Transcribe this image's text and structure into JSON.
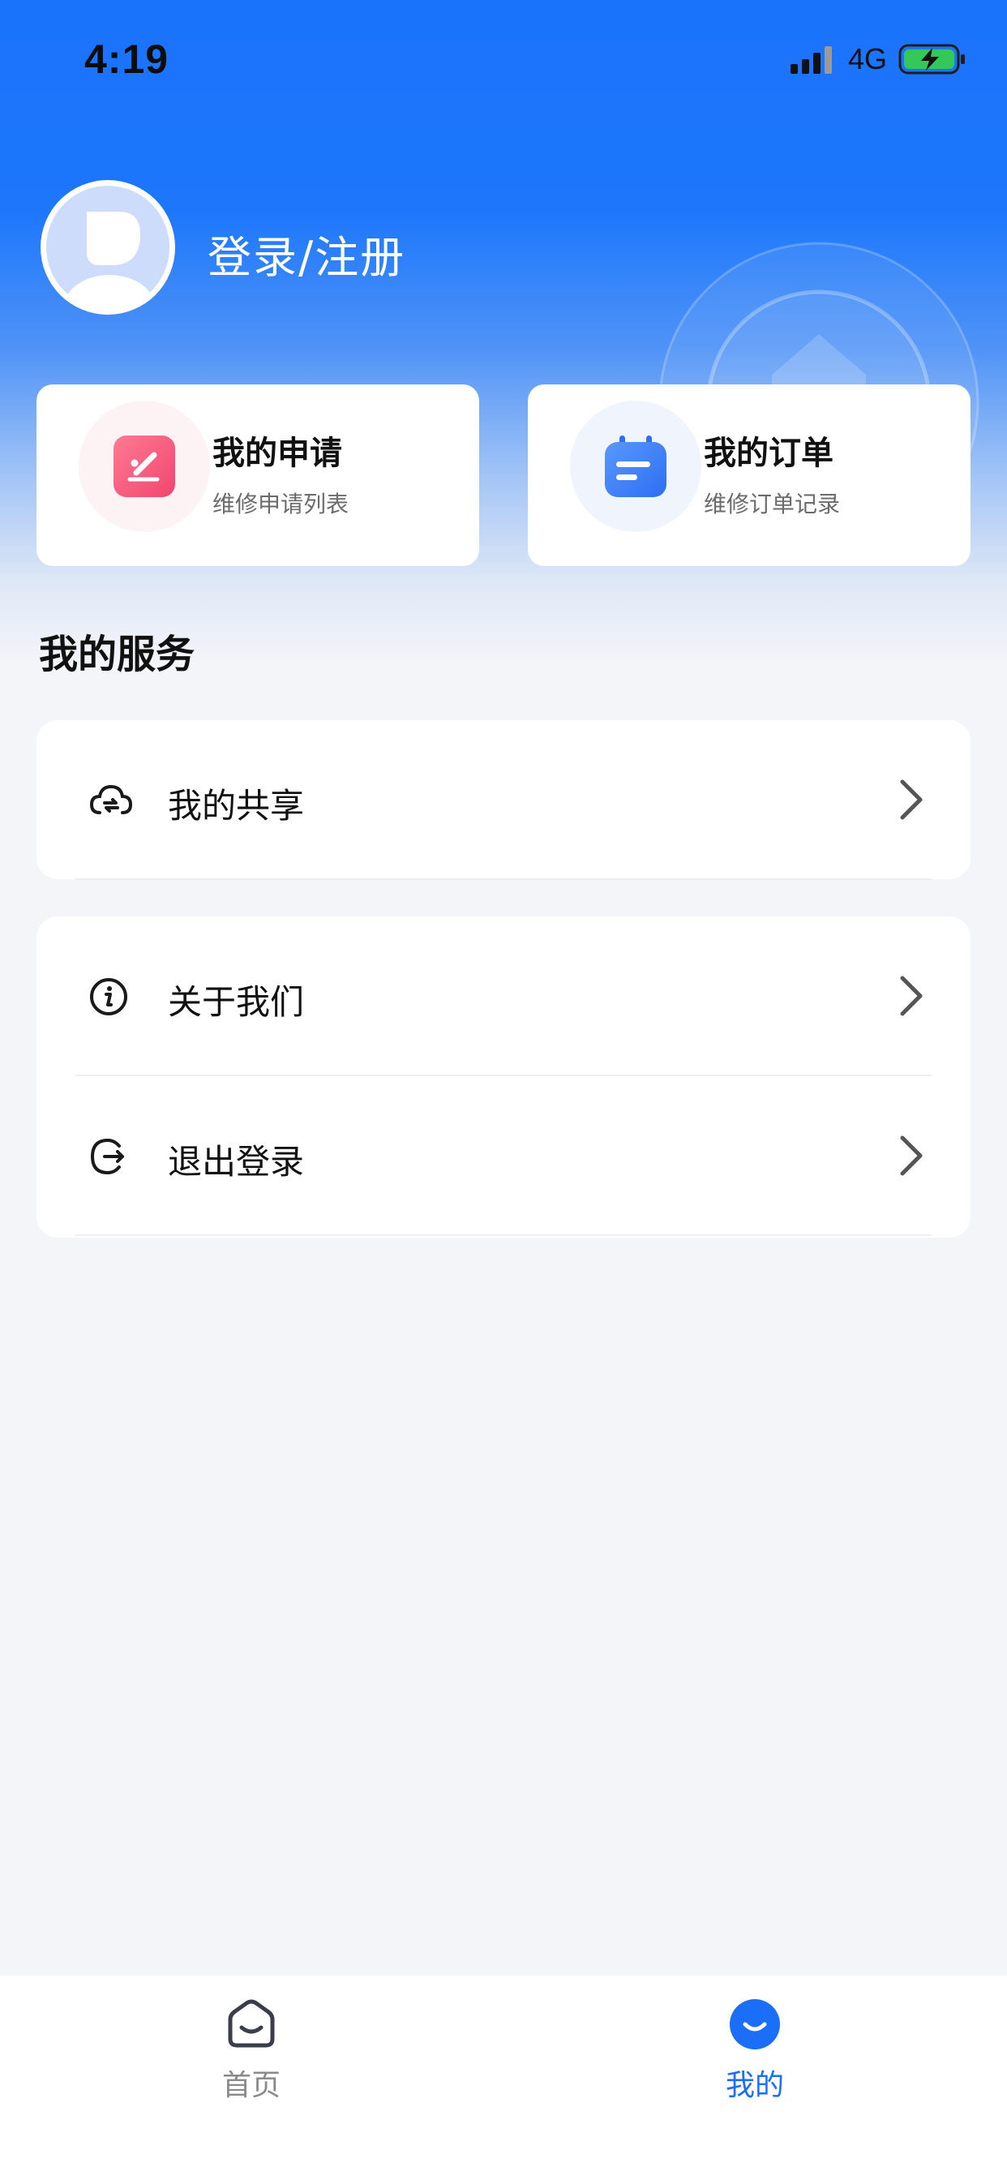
{
  "status_bar": {
    "time": "4:19",
    "network": "4G",
    "signal_bars_active": 3,
    "signal_bars_total": 4,
    "battery_charging": true
  },
  "profile": {
    "login_label": "登录/注册"
  },
  "quick_cards": [
    {
      "title": "我的申请",
      "subtitle": "维修申请列表",
      "icon": "edit-document-icon",
      "color": "#f25c7f"
    },
    {
      "title": "我的订单",
      "subtitle": "维修订单记录",
      "icon": "calendar-list-icon",
      "color": "#3a7ef7"
    }
  ],
  "services": {
    "title": "我的服务",
    "groups": [
      [
        {
          "label": "我的共享",
          "icon": "cloud-share-icon"
        }
      ],
      [
        {
          "label": "关于我们",
          "icon": "info-icon"
        },
        {
          "label": "退出登录",
          "icon": "logout-icon"
        }
      ]
    ]
  },
  "tabbar": {
    "items": [
      {
        "label": "首页",
        "icon": "home-smile-icon",
        "active": false
      },
      {
        "label": "我的",
        "icon": "profile-smile-icon",
        "active": true
      }
    ]
  },
  "colors": {
    "primary": "#1b6ef7",
    "background": "#f4f5f9",
    "inactive_tab": "#8a8a8a"
  }
}
